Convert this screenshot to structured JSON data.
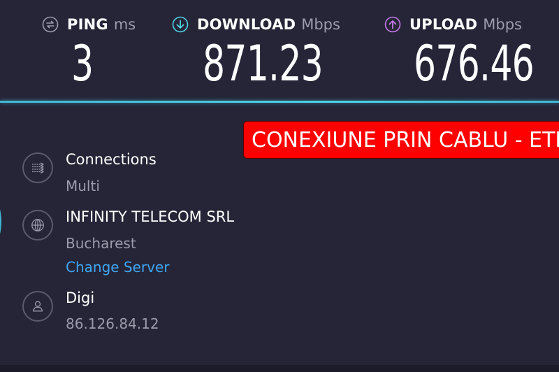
{
  "metrics": {
    "ping": {
      "label": "PING",
      "unit": "ms",
      "value": "3",
      "icon": "ping-icon",
      "color": "#9c9bab"
    },
    "download": {
      "label": "DOWNLOAD",
      "unit": "Mbps",
      "value": "871.23",
      "icon": "download-icon",
      "color": "#4ed3e6"
    },
    "upload": {
      "label": "UPLOAD",
      "unit": "Mbps",
      "value": "676.46",
      "icon": "upload-icon",
      "color": "#c37ae6"
    }
  },
  "banner": {
    "text": "CONEXIUNE PRIN CABLU - ETH",
    "color": "#ff0000"
  },
  "info": {
    "connections": {
      "title": "Connections",
      "value": "Multi",
      "icon": "connections-icon"
    },
    "server": {
      "title": "INFINITY TELECOM SRL",
      "location": "Bucharest",
      "change_label": "Change Server",
      "icon": "globe-icon"
    },
    "isp": {
      "title": "Digi",
      "ip": "86.126.84.12",
      "icon": "user-icon"
    }
  },
  "colors": {
    "background": "#262537",
    "accent": "#3fb8d4",
    "link": "#3da6f5"
  }
}
